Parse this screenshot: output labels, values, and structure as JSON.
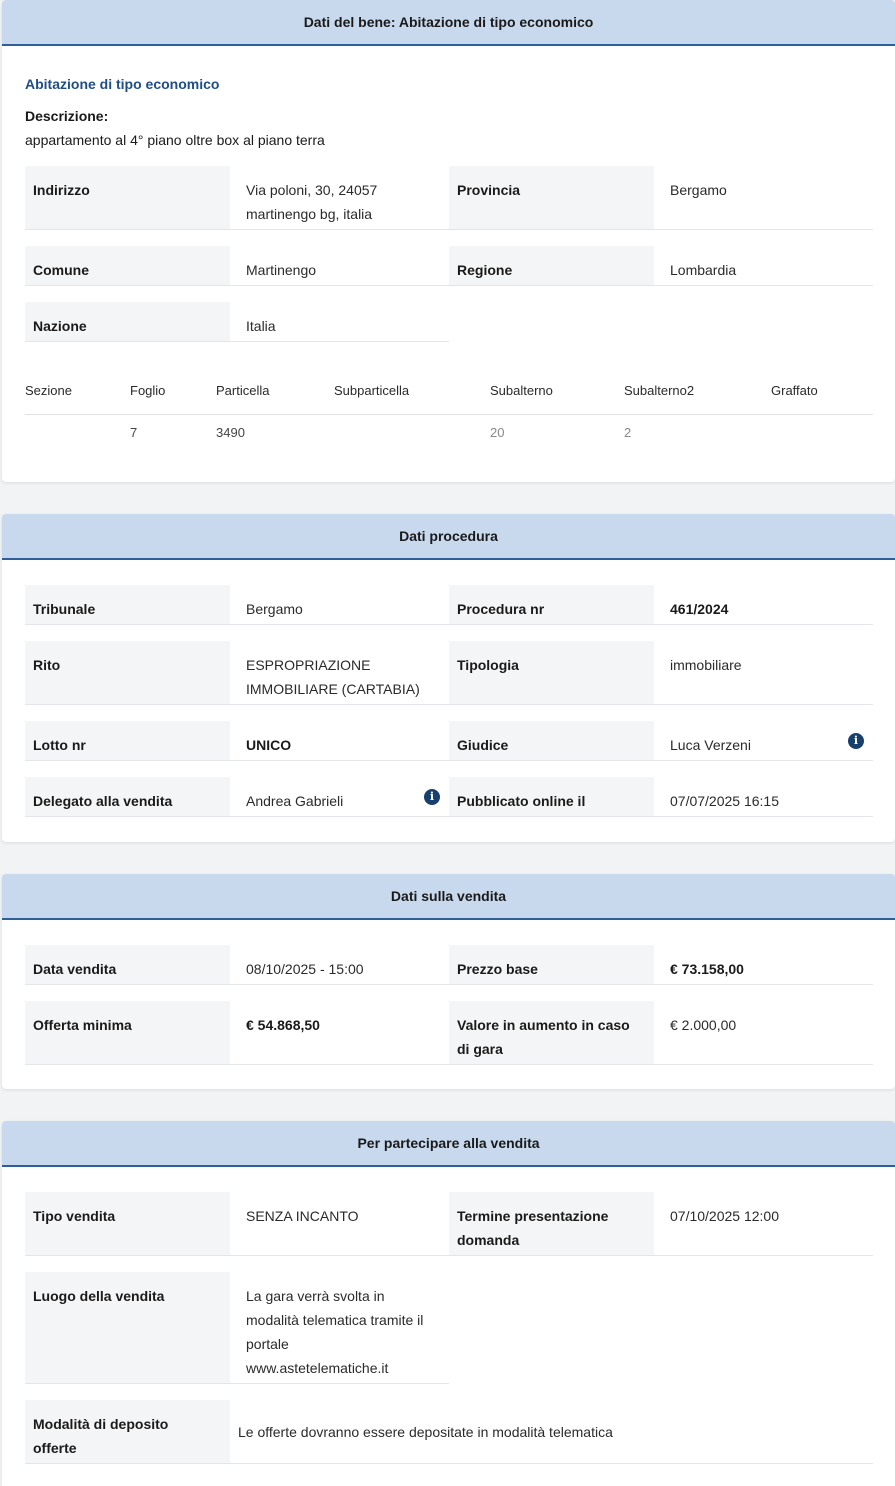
{
  "bene": {
    "header": "Dati del bene: Abitazione di tipo economico",
    "title": "Abitazione di tipo economico",
    "desc_label": "Descrizione:",
    "desc_text": "appartamento al 4° piano oltre box al piano terra",
    "indirizzo_label": "Indirizzo",
    "indirizzo_line1": "Via poloni, 30, 24057",
    "indirizzo_line2": "martinengo bg, italia",
    "provincia_label": "Provincia",
    "provincia_value": "Bergamo",
    "comune_label": "Comune",
    "comune_value": "Martinengo",
    "regione_label": "Regione",
    "regione_value": "Lombardia",
    "nazione_label": "Nazione",
    "nazione_value": "Italia",
    "catasto": {
      "headers": [
        "Sezione",
        "Foglio",
        "Particella",
        "Subparticella",
        "Subalterno",
        "Subalterno2",
        "Graffato"
      ],
      "row": [
        "",
        "7",
        "3490",
        "",
        "20",
        "2",
        ""
      ]
    }
  },
  "procedura": {
    "header": "Dati procedura",
    "tribunale_label": "Tribunale",
    "tribunale_value": "Bergamo",
    "procedura_label": "Procedura nr",
    "procedura_value": "461/2024",
    "rito_label": "Rito",
    "rito_line1": "ESPROPRIAZIONE",
    "rito_line2": "IMMOBILIARE (CARTABIA)",
    "tipologia_label": "Tipologia",
    "tipologia_value": "immobiliare",
    "lotto_label": "Lotto nr",
    "lotto_value": "UNICO",
    "giudice_label": "Giudice",
    "giudice_value": "Luca Verzeni",
    "delegato_label": "Delegato alla vendita",
    "delegato_value": "Andrea Gabrieli",
    "pubblicato_label": "Pubblicato online il",
    "pubblicato_value": "07/07/2025 16:15"
  },
  "vendita": {
    "header": "Dati sulla vendita",
    "data_label": "Data vendita",
    "data_value": "08/10/2025 - 15:00",
    "prezzo_label": "Prezzo base",
    "prezzo_value": "€ 73.158,00",
    "offerta_label": "Offerta minima",
    "offerta_value": "€ 54.868,50",
    "aumento_line1": "Valore in aumento in caso",
    "aumento_line2": "di gara",
    "aumento_value": "€ 2.000,00"
  },
  "partecipare": {
    "header": "Per partecipare alla vendita",
    "tipo_label": "Tipo vendita",
    "tipo_value": "SENZA INCANTO",
    "termine_line1": "Termine presentazione",
    "termine_line2": "domanda",
    "termine_value": "07/10/2025 12:00",
    "luogo_label": "Luogo della vendita",
    "luogo_lines": [
      "La gara verrà svolta in",
      "modalità telematica tramite il",
      "portale",
      "www.astetelematiche.it"
    ],
    "modalita_line1": "Modalità di deposito",
    "modalita_line2": "offerte",
    "modalita_value": "Le offerte dovranno essere depositate in modalità telematica"
  },
  "colors": {
    "header_bg": "#c8d9ee",
    "header_border": "#2f5f98",
    "title_blue": "#1f4e85",
    "label_bg": "#f4f5f7",
    "info_icon": "#17406d"
  }
}
